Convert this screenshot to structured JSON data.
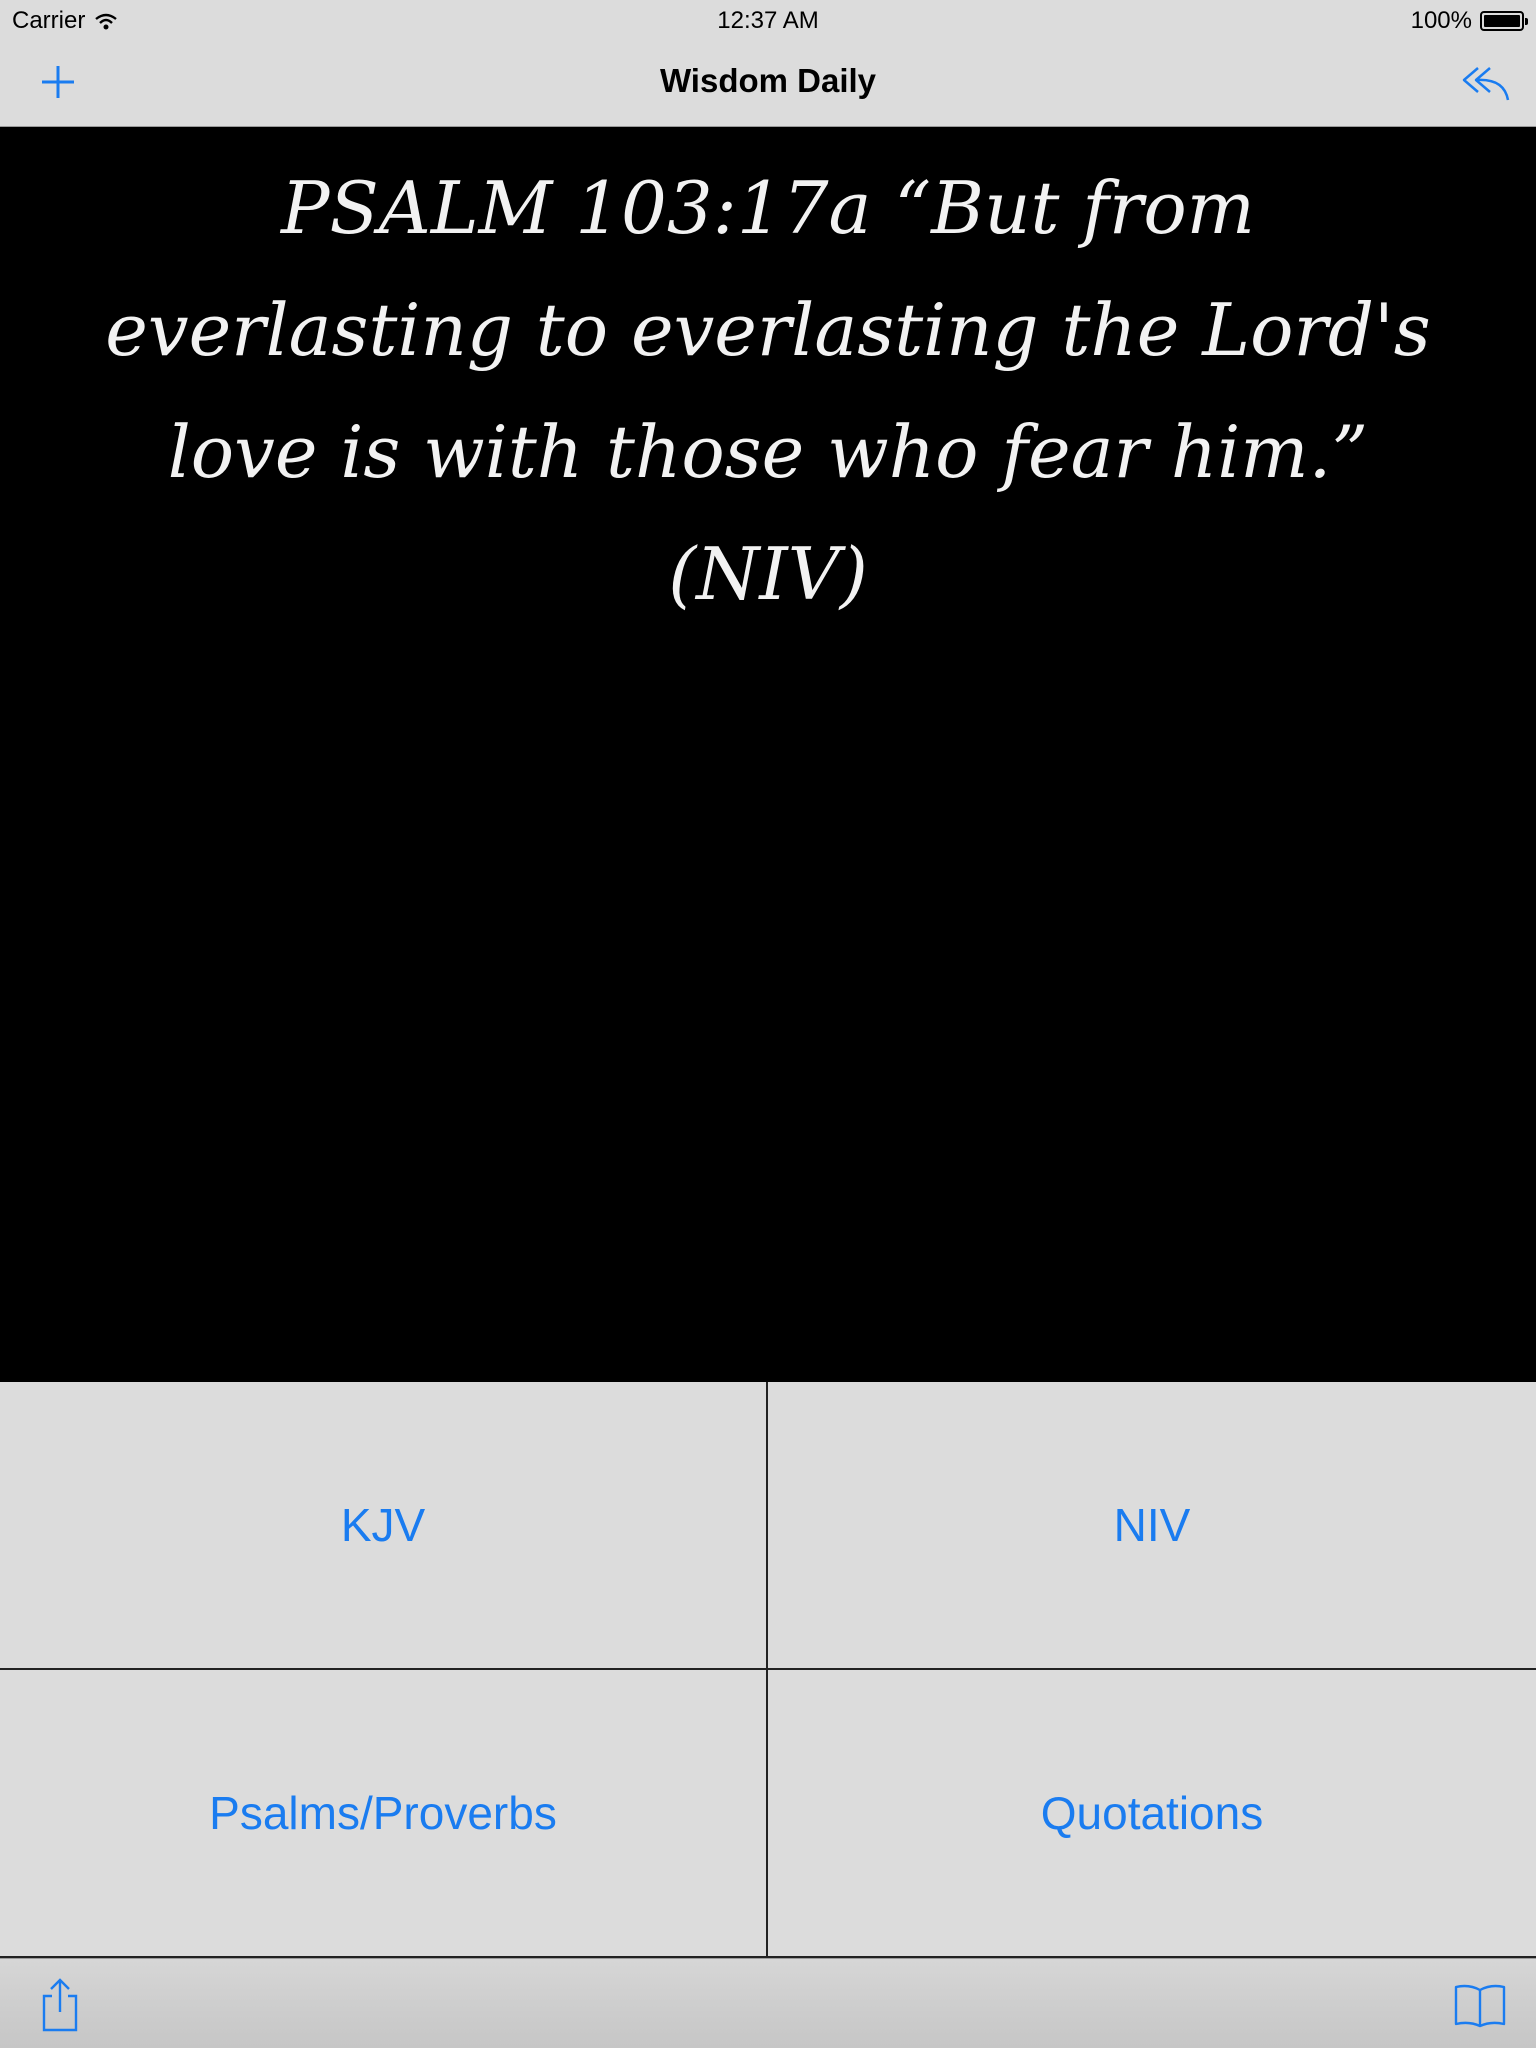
{
  "status_bar": {
    "carrier": "Carrier",
    "time": "12:37 AM",
    "battery": "100%"
  },
  "nav_bar": {
    "title": "Wisdom Daily",
    "left_icon": "plus-icon",
    "right_icon": "reply-icon"
  },
  "verse": {
    "text": "PSALM 103:17a “But from everlasting to everlasting the Lord's love is with those who fear him.”  (NIV)"
  },
  "buttons": [
    {
      "label": "KJV"
    },
    {
      "label": "NIV"
    },
    {
      "label": "Psalms/Proverbs"
    },
    {
      "label": "Quotations"
    }
  ],
  "toolbar": {
    "left_icon": "share-icon",
    "right_icon": "book-icon"
  },
  "colors": {
    "accent": "#1a7cf0",
    "bar_background": "#dcdcdc",
    "content_background": "#000000",
    "verse_text": "#f2f2f2"
  }
}
